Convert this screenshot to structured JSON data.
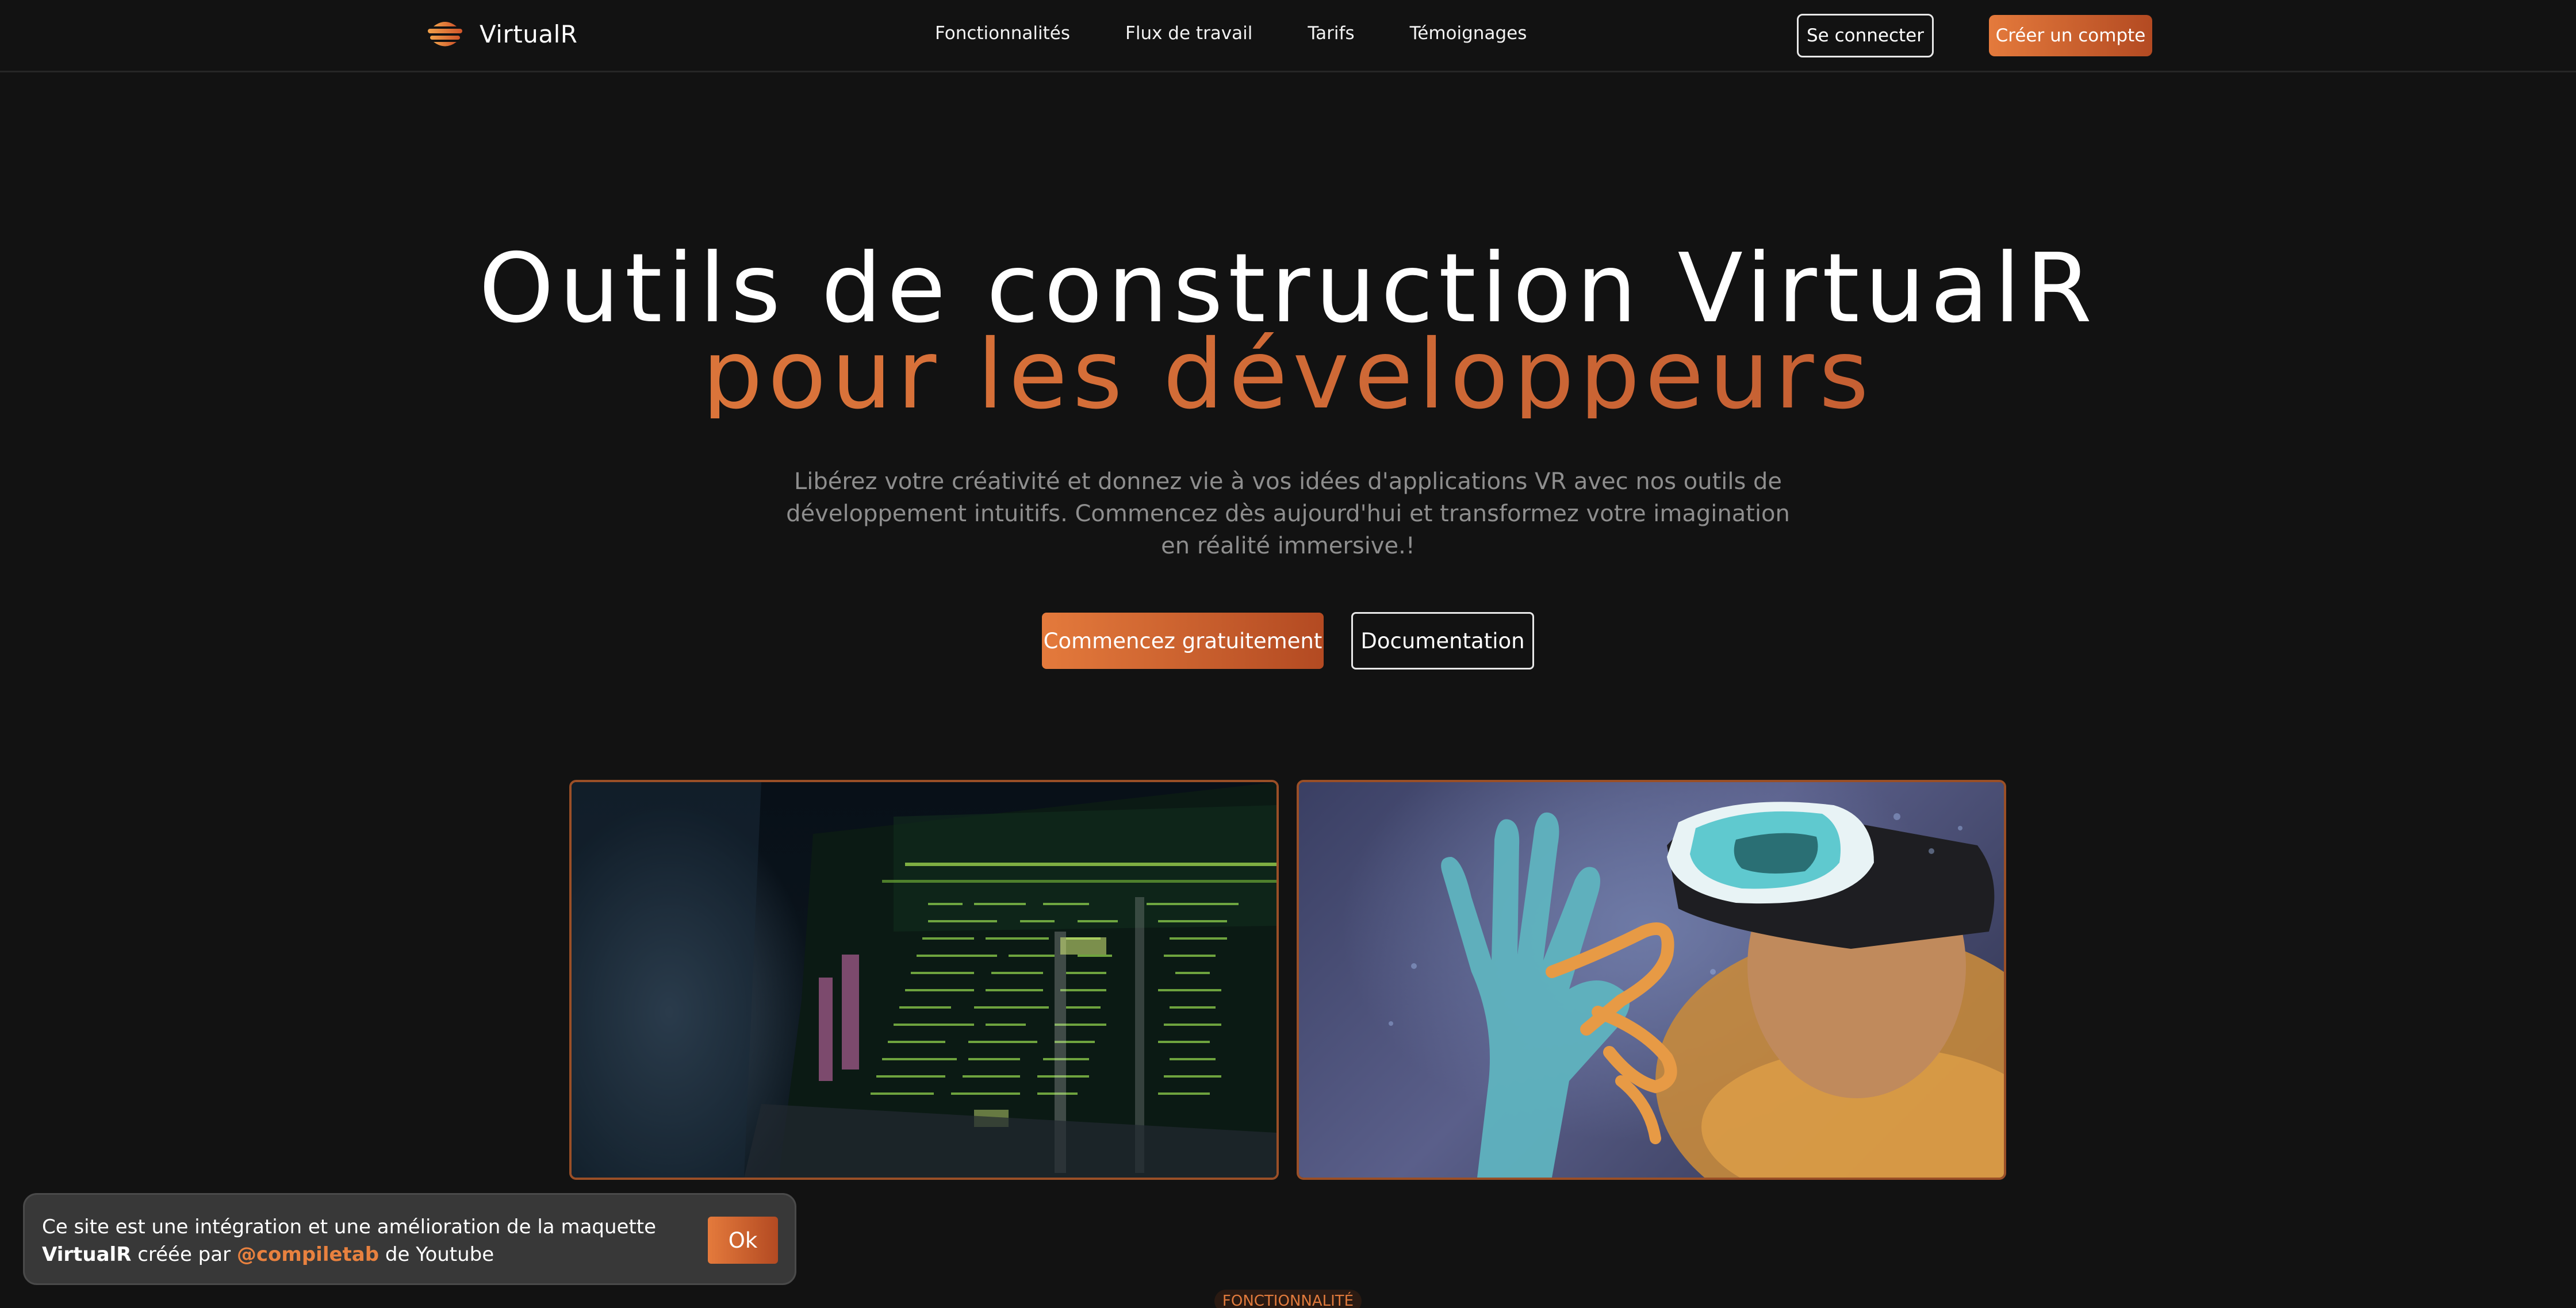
{
  "nav": {
    "brand": "VirtualR",
    "links": [
      "Fonctionnalités",
      "Flux de travail",
      "Tarifs",
      "Témoignages"
    ],
    "login_label": "Se connecter",
    "signup_label": "Créer un compte"
  },
  "hero": {
    "title_line1": "Outils de construction VirtualR",
    "title_line2": "pour les développeurs",
    "subtitle": "Libérez votre créativité et donnez vie à vos idées d'applications VR avec nos outils de développement intuitifs. Commencez dès aujourd'hui et transformez votre imagination en réalité immersive.!",
    "cta_primary": "Commencez gratuitement",
    "cta_secondary": "Documentation"
  },
  "notice": {
    "text_part1": "Ce site est une intégration et une amélioration de la maquette",
    "brand": "VirtualR",
    "text_part2": "créée par",
    "author": "@compiletab",
    "text_part3": "de Youtube",
    "ok_label": "Ok"
  },
  "section": {
    "tag": "FONCTIONNALITÉ"
  },
  "colors": {
    "accent_start": "#e8813f",
    "accent_end": "#b8532e",
    "background": "#121212"
  }
}
